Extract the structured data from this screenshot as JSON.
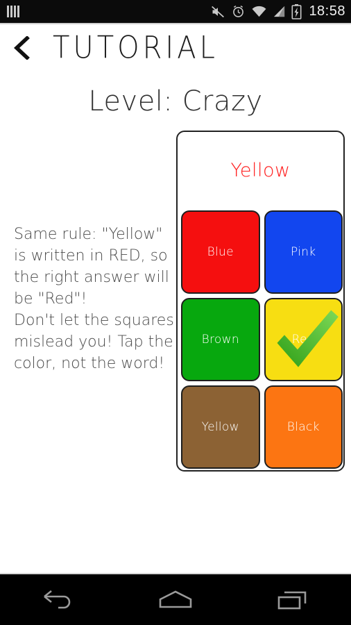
{
  "status_bar": {
    "left_icons": [
      {
        "name": "signal-bars-icon"
      }
    ],
    "right_icons": [
      {
        "name": "volume-muted-icon"
      },
      {
        "name": "alarm-clock-icon"
      },
      {
        "name": "wifi-icon"
      },
      {
        "name": "cellular-signal-icon"
      },
      {
        "name": "battery-charging-icon"
      }
    ],
    "clock": "18:58",
    "background": "#0b0b0b",
    "icon_color": "#c9c9c9"
  },
  "app_bar": {
    "back_icon": "chevron-left-icon",
    "title": "TUTORIAL"
  },
  "level_heading": "Level: Crazy",
  "description": "Same rule: \"Yellow\" is written in RED, so the right answer will be \"Red\"!\nDon't let the squares mislead you! Tap the color, not the word!",
  "game_card": {
    "prompt": {
      "text": "Yellow",
      "color": "#ff1a1a"
    },
    "tiles": [
      {
        "label": "Blue",
        "color": "#f50f0f",
        "correct": false
      },
      {
        "label": "Pink",
        "color": "#1246ef",
        "correct": false
      },
      {
        "label": "Brown",
        "color": "#07a80e",
        "correct": false
      },
      {
        "label": "Red",
        "color": "#f7de12",
        "correct": true
      },
      {
        "label": "Yellow",
        "color": "#8c6234",
        "correct": false
      },
      {
        "label": "Black",
        "color": "#fc7512",
        "correct": false
      }
    ],
    "check_icon": "check-mark-icon",
    "check_color": "#4cb524"
  },
  "nav_bar": {
    "buttons": [
      {
        "name": "nav-back-button",
        "icon": "back-arrow-icon"
      },
      {
        "name": "nav-home-button",
        "icon": "home-icon"
      },
      {
        "name": "nav-recents-button",
        "icon": "recents-icon"
      }
    ],
    "background": "#000000",
    "icon_color": "#9a9a9a"
  }
}
